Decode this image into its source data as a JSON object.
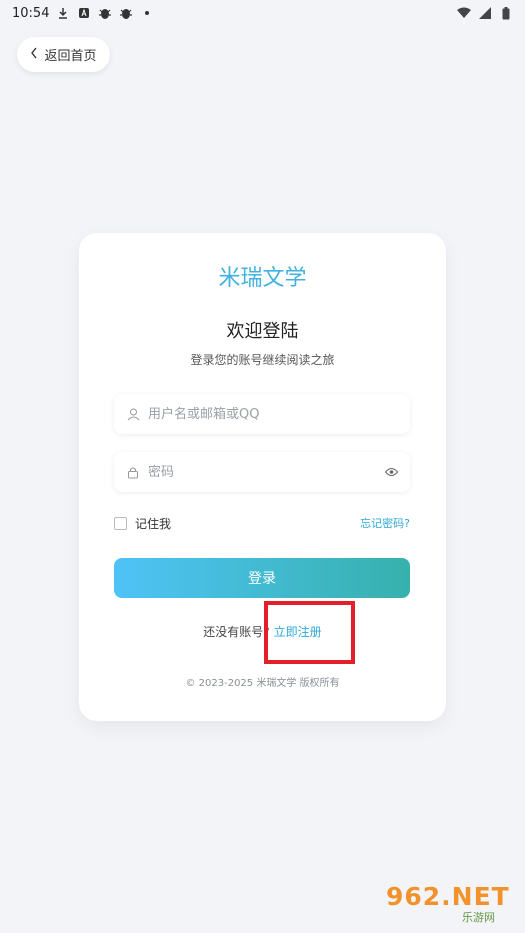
{
  "status_bar": {
    "time": "10:54",
    "left_icons": [
      "download-icon",
      "a-icon",
      "bug-icon",
      "bug-icon",
      "dot-icon"
    ],
    "right_icons": [
      "wifi-icon",
      "signal-icon",
      "battery-icon"
    ]
  },
  "header": {
    "back_label": "返回首页"
  },
  "card": {
    "brand": "米瑞文学",
    "welcome": "欢迎登陆",
    "subtitle": "登录您的账号继续阅读之旅",
    "username": {
      "placeholder": "用户名或邮箱或QQ",
      "value": ""
    },
    "password": {
      "placeholder": "密码",
      "value": ""
    },
    "remember_label": "记住我",
    "forgot_label": "忘记密码?",
    "login_label": "登录",
    "signup_prompt": "还没有账号?",
    "signup_link": "立即注册",
    "copyright": "© 2023-2025 米瑞文学 版权所有"
  },
  "watermark": {
    "top": "962.NET",
    "bottom": "乐游网"
  },
  "colors": {
    "accent": "#3fb2df",
    "button_start": "#4fc3f7",
    "button_end": "#36b1ad",
    "highlight": "#e3202a",
    "background": "#f3f4f8"
  }
}
